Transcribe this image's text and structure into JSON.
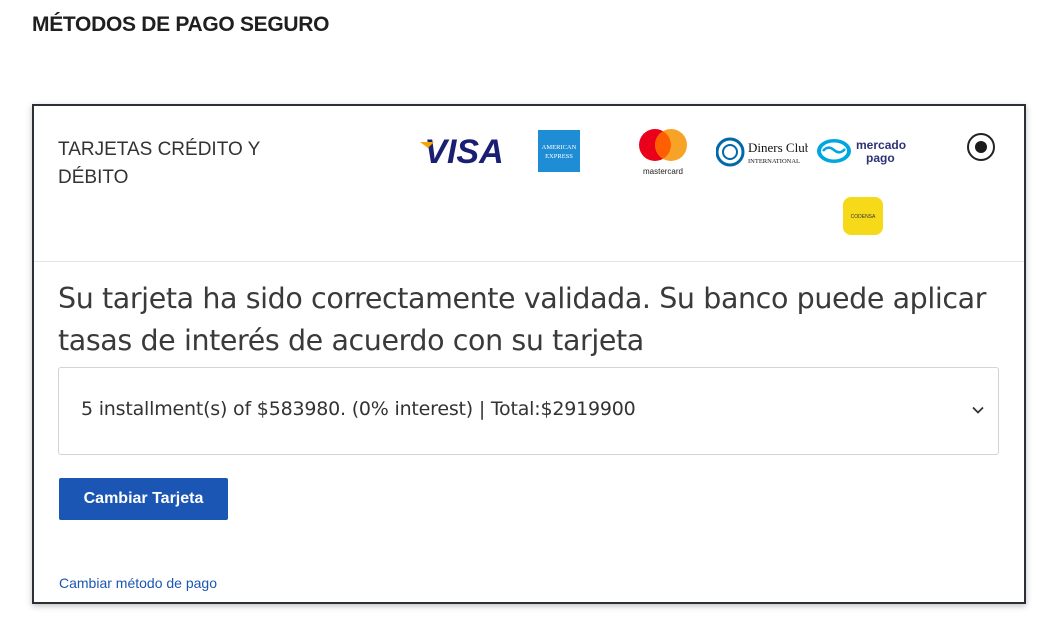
{
  "page": {
    "title": "MÉTODOS DE PAGO SEGURO"
  },
  "payment_method": {
    "label": "TARJETAS CRÉDITO Y DÉBITO",
    "selected": true,
    "logos": [
      {
        "name": "visa-logo",
        "text": "VISA"
      },
      {
        "name": "amex-logo",
        "text": "AMERICAN EXPRESS"
      },
      {
        "name": "mastercard-logo",
        "text": "mastercard"
      },
      {
        "name": "diners-club-logo",
        "text": "Diners Club INTERNATIONAL"
      },
      {
        "name": "mercado-pago-logo",
        "text": "mercado pago"
      },
      {
        "name": "codensa-logo",
        "text": "CODENSA"
      }
    ]
  },
  "validation": {
    "message": "Su tarjeta ha sido correctamente validada. Su banco puede aplicar tasas de interés de acuerdo con su tarjeta"
  },
  "installments": {
    "selected_option": "5 installment(s) of $583980. (0% interest) | Total:$2919900"
  },
  "actions": {
    "change_card_label": "Cambiar Tarjeta",
    "change_method_label": "Cambiar método de pago"
  },
  "colors": {
    "primary": "#1b56b5",
    "border": "#2b2f36"
  }
}
